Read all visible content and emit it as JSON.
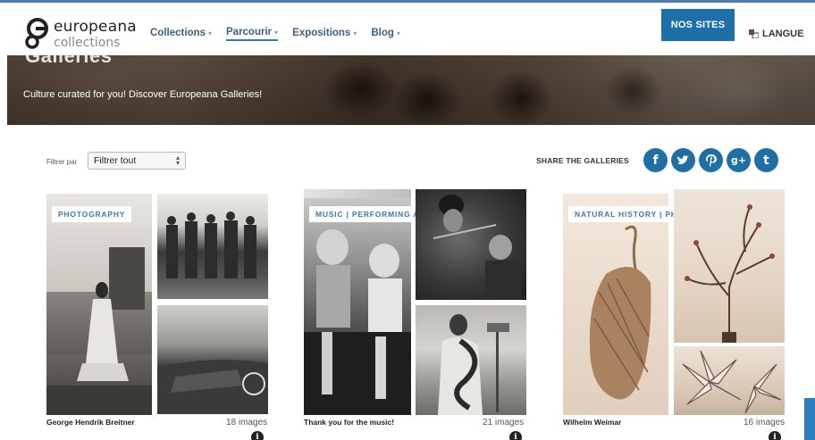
{
  "header": {
    "logo_line1": "europeana",
    "logo_line2": "collections",
    "nav": [
      {
        "label": "Collections",
        "active": false
      },
      {
        "label": "Parcourir",
        "active": true
      },
      {
        "label": "Expositions",
        "active": false
      },
      {
        "label": "Blog",
        "active": false
      }
    ],
    "nos_sites": "NOS SITES",
    "langue": "LANGUE",
    "langue_icon": "translate-icon"
  },
  "banner": {
    "title": "Galleries",
    "text": "Culture curated for you! Discover Europeana Galleries!"
  },
  "filter": {
    "label": "Filtrer par",
    "selected": "Filtrer tout"
  },
  "share": {
    "label": "SHARE THE GALLERIES",
    "icons": [
      {
        "name": "facebook-icon",
        "glyph": "f"
      },
      {
        "name": "twitter-icon",
        "glyph": "t"
      },
      {
        "name": "pinterest-icon",
        "glyph": "p"
      },
      {
        "name": "googleplus-icon",
        "glyph": "g+"
      },
      {
        "name": "tumblr-icon",
        "glyph": "t"
      }
    ]
  },
  "galleries": [
    {
      "tag": "PHOTOGRAPHY",
      "title": "George Hendrik Breitner",
      "count": "18 images"
    },
    {
      "tag": "MUSIC | PERFORMING AR...",
      "title": "Thank you for the music!",
      "count": "21 images"
    },
    {
      "tag": "NATURAL HISTORY | PH...",
      "title": "Wilhelm Weimar",
      "count": "16 images"
    }
  ],
  "colors": {
    "accent": "#1c6fa8",
    "nav_text": "#3b5f80",
    "tag_text": "#3a79ad"
  }
}
